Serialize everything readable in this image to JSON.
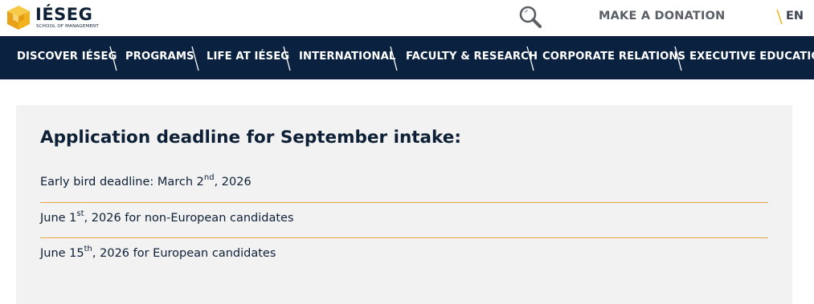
{
  "brand": {
    "name": "IÉSEG",
    "tagline": "SCHOOL OF MANAGEMENT"
  },
  "header": {
    "search_icon": "magnifier-icon",
    "donate_label": "MAKE A DONATION",
    "language": "EN"
  },
  "nav": {
    "items": [
      {
        "label": "DISCOVER IÉSEG"
      },
      {
        "label": "PROGRAMS"
      },
      {
        "label": "LIFE AT IÉSEG"
      },
      {
        "label": "INTERNATIONAL"
      },
      {
        "label": "FACULTY & RESEARCH"
      },
      {
        "label": "CORPORATE RELATIONS"
      },
      {
        "label": "EXECUTIVE EDUCATION"
      }
    ]
  },
  "deadlines": {
    "title": "Application deadline for September intake:",
    "items": [
      {
        "before": "Early bird deadline: March 2",
        "sup": "nd",
        "after": ", 2026"
      },
      {
        "before": "June 1",
        "sup": "st",
        "after": ", 2026 for non-European candidates"
      },
      {
        "before": "June 15",
        "sup": "th",
        "after": ", 2026 for European candidates"
      }
    ]
  },
  "colors": {
    "navy": "#0a2240",
    "accent": "#f2b21b",
    "divider": "#e8a33d",
    "card_bg": "#f2f2f2"
  }
}
